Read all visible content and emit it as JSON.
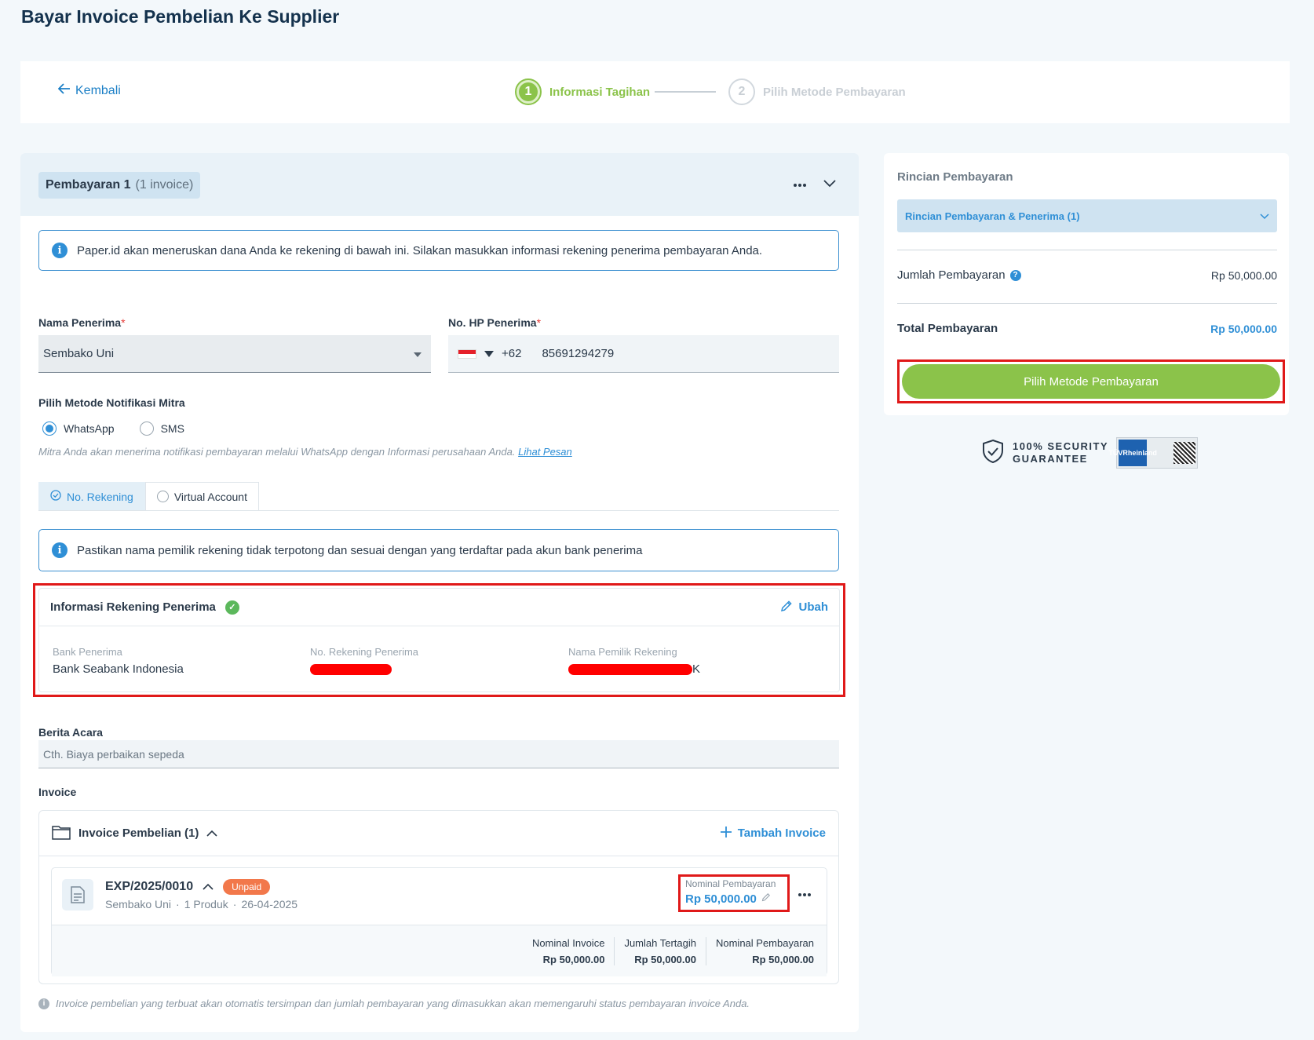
{
  "page": {
    "title": "Bayar Invoice Pembelian Ke Supplier"
  },
  "stepbar": {
    "back_label": "Kembali",
    "step1_num": "1",
    "step1_label": "Informasi Tagihan",
    "step2_num": "2",
    "step2_label": "Pilih Metode Pembayaran"
  },
  "payment": {
    "chip_title": "Pembayaran 1",
    "chip_count": "(1 invoice)",
    "info_text": "Paper.id akan meneruskan dana Anda ke rekening di bawah ini. Silakan masukkan informasi rekening penerima pembayaran Anda.",
    "recipient_label": "Nama Penerima",
    "recipient_value": "Sembako Uni",
    "phone_label": "No. HP Penerima",
    "phone_code": "+62",
    "phone_value": "85691294279",
    "required_mark": "*",
    "notif_label": "Pilih Metode Notifikasi Mitra",
    "notif_options": [
      "WhatsApp",
      "SMS"
    ],
    "notif_selected": "WhatsApp",
    "notif_hint": "Mitra Anda akan menerima notifikasi pembayaran melalui WhatsApp dengan Informasi perusahaan Anda.",
    "notif_hint_link": "Lihat Pesan",
    "tabs": [
      "No. Rekening",
      "Virtual Account"
    ],
    "tab_active": "No. Rekening",
    "account_info_text": "Pastikan nama pemilik rekening tidak terpotong dan sesuai dengan yang terdaftar pada akun bank penerima"
  },
  "account": {
    "title": "Informasi Rekening Penerima",
    "edit_label": "Ubah",
    "bank_label": "Bank Penerima",
    "bank_value": "Bank Seabank Indonesia",
    "number_label": "No. Rekening Penerima",
    "owner_label": "Nama Pemilik Rekening",
    "owner_suffix": "K"
  },
  "memo": {
    "label": "Berita Acara",
    "placeholder": "Cth. Biaya perbaikan sepeda"
  },
  "invoice": {
    "section_label": "Invoice",
    "group_title": "Invoice Pembelian (1)",
    "add_label": "Tambah Invoice",
    "items": [
      {
        "number": "EXP/2025/0010",
        "status": "Unpaid",
        "supplier": "Sembako Uni",
        "products": "1 Produk",
        "date": "26-04-2025",
        "nominal_label": "Nominal Pembayaran",
        "nominal_value": "Rp 50,000.00",
        "summary": [
          {
            "label": "Nominal Invoice",
            "value": "Rp 50,000.00"
          },
          {
            "label": "Jumlah Tertagih",
            "value": "Rp 50,000.00"
          },
          {
            "label": "Nominal Pembayaran",
            "value": "Rp 50,000.00"
          }
        ]
      }
    ],
    "footnote": "Invoice pembelian yang terbuat akan otomatis tersimpan dan jumlah pembayaran yang dimasukkan akan memengaruhi status pembayaran invoice Anda."
  },
  "summary": {
    "title": "Rincian Pembayaran",
    "accordion_label": "Rincian Pembayaran & Penerima (1)",
    "amount_label": "Jumlah Pembayaran",
    "amount_value": "Rp 50,000.00",
    "total_label": "Total Pembayaran",
    "total_value": "Rp 50,000.00",
    "button_label": "Pilih Metode Pembayaran"
  },
  "security": {
    "line1": "100% SECURITY",
    "line2": "GUARANTEE",
    "cert_text": "TÜVRheinland"
  },
  "colors": {
    "accent_blue": "#2f8fd6",
    "accent_green": "#8bc34a",
    "highlight_red": "#e01919",
    "badge_unpaid": "#f2784b"
  }
}
